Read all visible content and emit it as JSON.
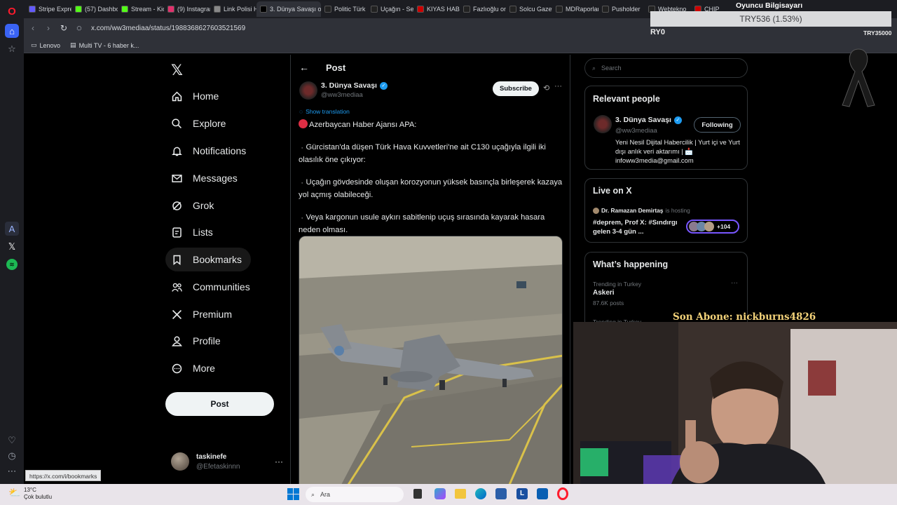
{
  "browser": {
    "tabs": [
      {
        "label": "Stripe Expres",
        "color": "#635bff"
      },
      {
        "label": "(57) Dashbo",
        "color": "#53fc18"
      },
      {
        "label": "Stream - Kic",
        "color": "#53fc18"
      },
      {
        "label": "(9) Instagram",
        "color": "#e1306c"
      },
      {
        "label": "Link Polisi H",
        "color": "#888888"
      },
      {
        "label": "3. Dünya Savaşı on X",
        "color": "#000000",
        "active": true
      },
      {
        "label": "Politic Türk",
        "color": "#222222"
      },
      {
        "label": "Uçağın - Sea",
        "color": "#222222"
      },
      {
        "label": "KIYAS HABER",
        "color": "#cc0000"
      },
      {
        "label": "Fazlıoğlu on",
        "color": "#222222"
      },
      {
        "label": "Solcu Gazete",
        "color": "#222222"
      },
      {
        "label": "MDRaporlar",
        "color": "#222222"
      },
      {
        "label": "Pusholder",
        "color": "#222222"
      },
      {
        "label": "Webtekno",
        "color": "#222222"
      },
      {
        "label": "CHIP",
        "color": "#cc0000"
      }
    ],
    "url": "x.com/ww3mediaa/status/1988368627603521569",
    "bookmarks": [
      "Lenovo",
      "Multi TV - 6 haber k..."
    ],
    "status_url": "https://x.com/i/bookmarks"
  },
  "sidebar": {
    "logo": "𝕏",
    "items": [
      {
        "label": "Home",
        "icon": "home-icon"
      },
      {
        "label": "Explore",
        "icon": "search-icon"
      },
      {
        "label": "Notifications",
        "icon": "bell-icon"
      },
      {
        "label": "Messages",
        "icon": "mail-icon"
      },
      {
        "label": "Grok",
        "icon": "grok-icon"
      },
      {
        "label": "Lists",
        "icon": "list-icon"
      },
      {
        "label": "Bookmarks",
        "icon": "bookmark-icon"
      },
      {
        "label": "Communities",
        "icon": "people-icon"
      },
      {
        "label": "Premium",
        "icon": "x-icon"
      },
      {
        "label": "Profile",
        "icon": "person-icon"
      },
      {
        "label": "More",
        "icon": "more-circle-icon"
      }
    ],
    "post_label": "Post",
    "user": {
      "name": "taskinefe",
      "handle": "@Efetaskinnn"
    }
  },
  "main": {
    "header": "Post",
    "author": {
      "name": "3. Dünya Savaşı",
      "handle": "@ww3mediaa"
    },
    "subscribe_label": "Subscribe",
    "show_translation": "Show translation",
    "paragraphs": [
      "Azerbaycan Haber Ajansı APA:",
      "Gürcistan'da düşen Türk Hava Kuvvetleri'ne ait C130 uçağıyla ilgili iki olasılık öne çıkıyor:",
      "Uçağın gövdesinde oluşan korozyonun yüksek basınçla birleşerek kazaya yol açmış olabileceği.",
      "Veya kargonun usule aykırı sabitlenip uçuş sırasında kayarak hasara neden olması."
    ]
  },
  "right": {
    "search_placeholder": "Search",
    "relevant_title": "Relevant people",
    "relevant": {
      "name": "3. Dünya Savaşı",
      "handle": "@ww3mediaa",
      "button": "Following",
      "bio": "Yeni Nesil Dijital Habercilik | Yurt içi ve Yurt dışı anlık veri aktarımı | 📩 infoww3media@gmail.com"
    },
    "live_title": "Live on X",
    "live": {
      "host": "Dr. Ramazan Demirtaş",
      "hosting": "is hosting",
      "title": "#deprem, Prof X: #Sındırgı gelen 3-4 gün ...",
      "count": "+104"
    },
    "happening_title": "What’s happening",
    "trend": {
      "context": "Trending in Turkey",
      "name": "Askeri",
      "posts": "87.6K posts",
      "context2": "Trending in Turkey"
    }
  },
  "overlay": {
    "ticker": "TRY536 (1.53%)",
    "ticker_left": "RY0",
    "ticker_right": "TRY35000",
    "top_label": "Oyuncu Bilgisayarı",
    "subscriber": "Son Abone: nickburns4826"
  },
  "taskbar": {
    "temp": "13°C",
    "weather": "Çok bulutlu",
    "search": "Ara"
  },
  "colors": {
    "accent": "#1d9bf0",
    "bg": "#000000",
    "border": "#2f3336",
    "muted": "#71767b"
  }
}
